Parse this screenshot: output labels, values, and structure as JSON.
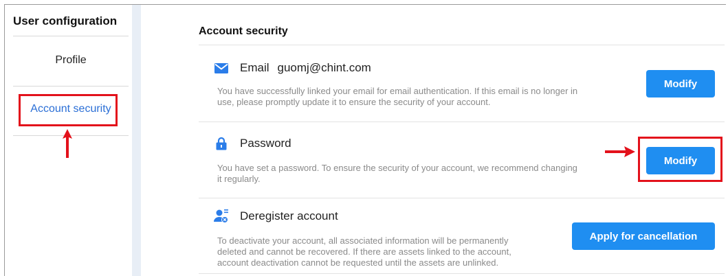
{
  "sidebar": {
    "title": "User configuration",
    "items": [
      {
        "label": "Profile"
      },
      {
        "label": "Account security"
      }
    ]
  },
  "main": {
    "title": "Account security",
    "email": {
      "label": "Email",
      "value": "guomj@chint.com",
      "description_line1": "You have successfully linked your email for email authentication. If this email is no longer in",
      "description_line2": "use, please promptly update it to ensure the security of your account.",
      "button": "Modify",
      "icon": "envelope-icon"
    },
    "password": {
      "label": "Password",
      "description_line1": "You have set a password. To ensure the security of your account, we recommend changing",
      "description_line2": "it regularly.",
      "button": "Modify",
      "icon": "lock-icon"
    },
    "deregister": {
      "label": "Deregister account",
      "description_line1": "To deactivate your account, all associated information will be permanently",
      "description_line2": "deleted and cannot be recovered. If there are assets linked to the account,",
      "description_line3": "account deactivation cannot be requested until the assets are unlinked.",
      "button": "Apply for cancellation",
      "icon": "user-delete-icon"
    }
  },
  "colors": {
    "accent": "#1f8ef1",
    "link": "#2b6fd6",
    "annotation": "#e3111b"
  }
}
